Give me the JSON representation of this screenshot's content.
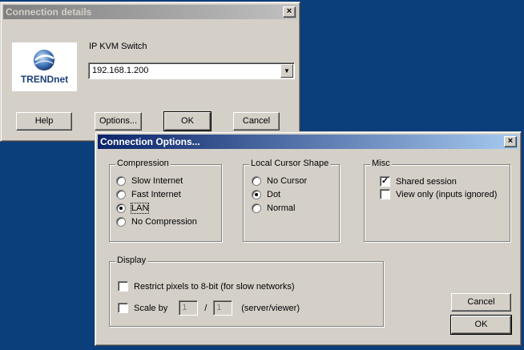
{
  "details_window": {
    "title": "Connection details",
    "device_label": "IP KVM Switch",
    "host_value": "192.168.1.200",
    "logo_text": "TRENDnet",
    "buttons": {
      "help": "Help",
      "options": "Options...",
      "ok": "OK",
      "cancel": "Cancel"
    }
  },
  "options_window": {
    "title": "Connection Options...",
    "compression": {
      "label": "Compression",
      "options": [
        "Slow Internet",
        "Fast Internet",
        "LAN",
        "No Compression"
      ],
      "selected": "LAN"
    },
    "cursor": {
      "label": "Local Cursor Shape",
      "options": [
        "No Cursor",
        "Dot",
        "Normal"
      ],
      "selected": "Dot"
    },
    "misc": {
      "label": "Misc",
      "shared_session": {
        "label": "Shared session",
        "checked": true
      },
      "view_only": {
        "label": "View only (inputs ignored)",
        "checked": false
      }
    },
    "display": {
      "label": "Display",
      "restrict_8bit": {
        "label": "Restrict pixels to 8-bit (for slow networks)",
        "checked": false
      },
      "scale": {
        "label": "Scale by",
        "numerator": "1",
        "separator": "/",
        "denominator": "1",
        "suffix": "(server/viewer)",
        "checked": false
      }
    },
    "buttons": {
      "cancel": "Cancel",
      "ok": "OK"
    }
  },
  "colors": {
    "desktop": "#0a3f7c",
    "window": "#d4d0c8",
    "active_title": "#0a246a"
  }
}
